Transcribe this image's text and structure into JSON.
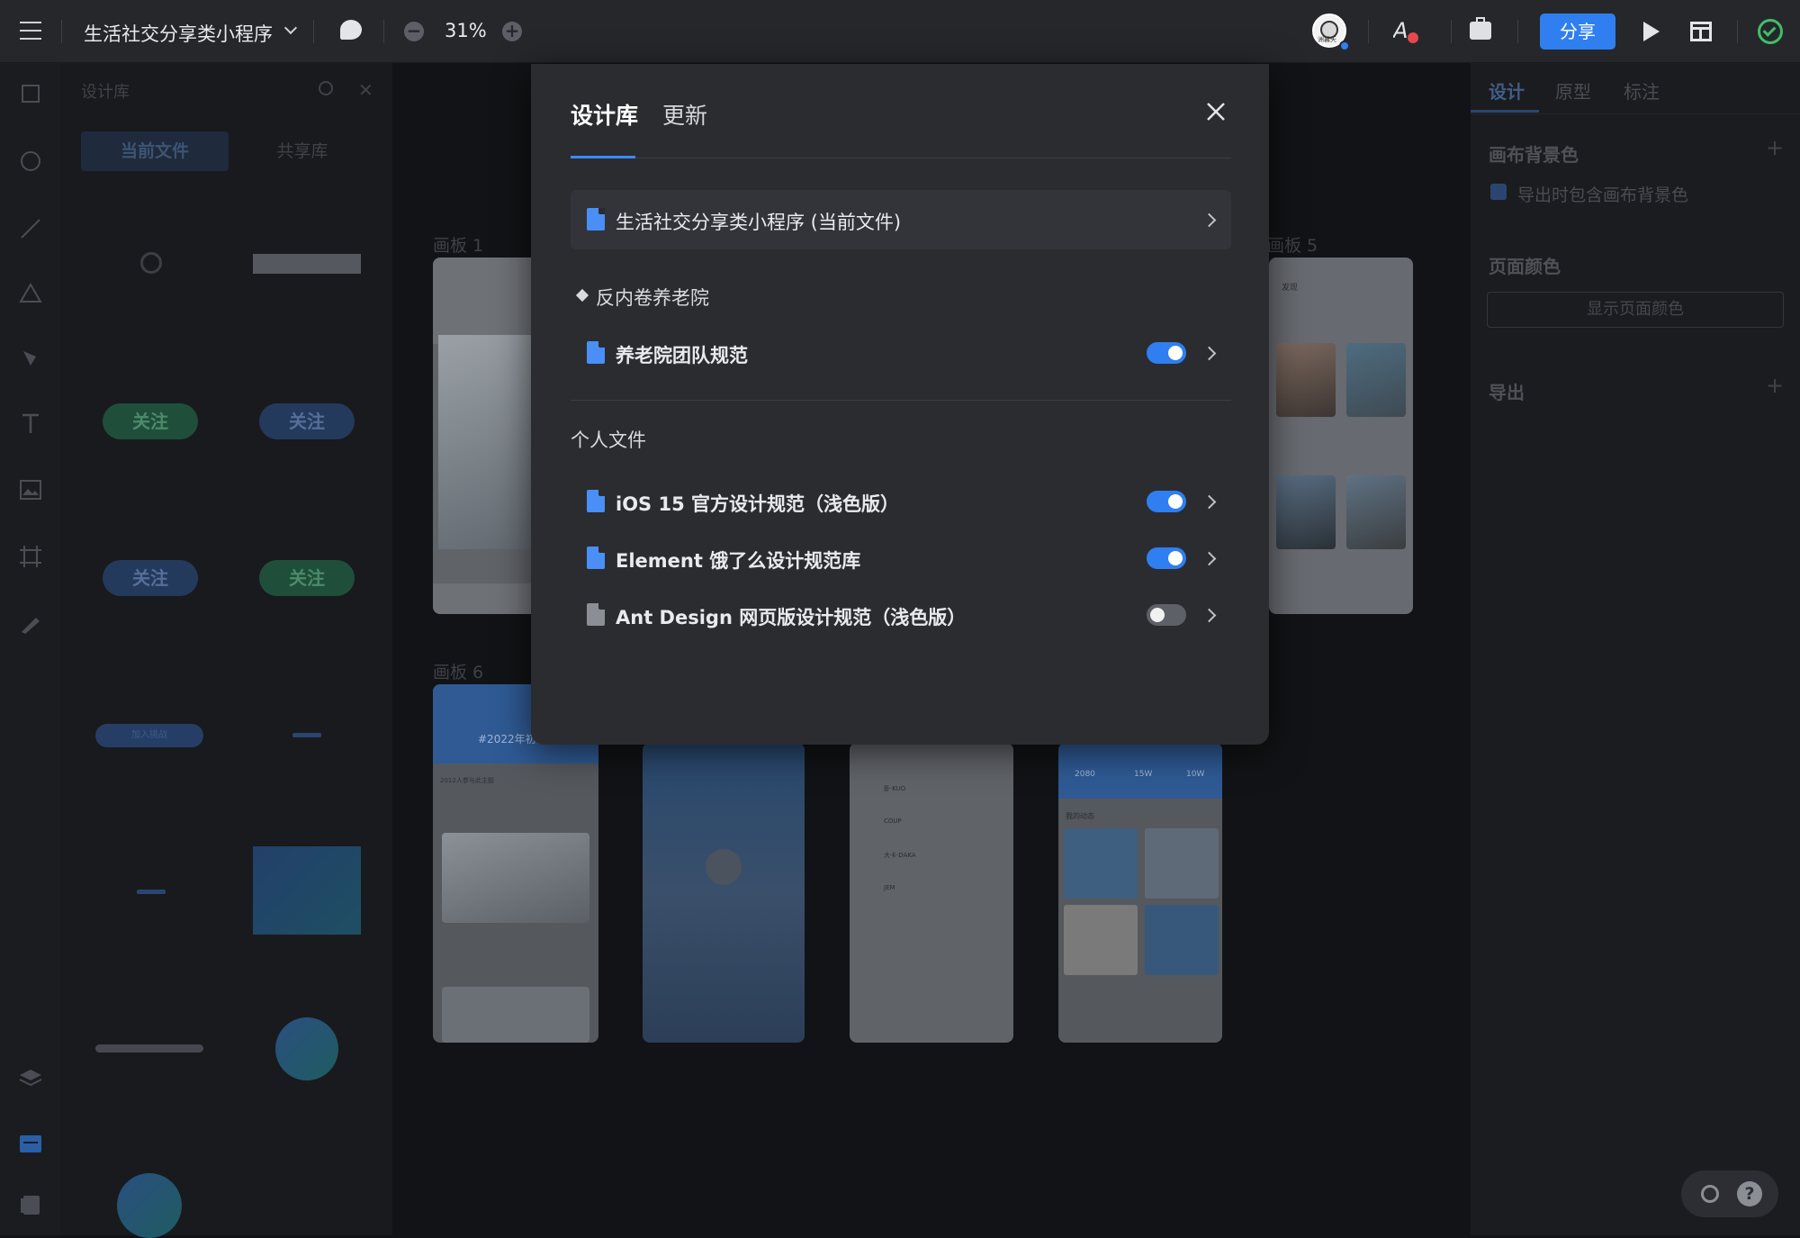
{
  "header": {
    "file_title": "生活社交分享类小程序",
    "zoom": "31%",
    "share_label": "分享",
    "avatar_text": "洲暮天"
  },
  "left_panel": {
    "title": "设计库",
    "tabs": [
      "当前文件",
      "共享库"
    ],
    "components": [
      "关注",
      "关注",
      "关注",
      "关注",
      "加入挑战"
    ]
  },
  "canvas": {
    "board_labels": [
      "画板 1",
      "画板 5",
      "画板 6"
    ],
    "board6_text": [
      "#2022年初雪",
      "2012人参与此主题"
    ],
    "chat_names": [
      "卧·KUO",
      "COUP",
      "大卡·DAKA",
      "JEM"
    ],
    "profile_stats": [
      "2080",
      "15W",
      "10W"
    ],
    "profile_section": "我的动态",
    "board5_title": "发现"
  },
  "right_panel": {
    "tabs": [
      "设计",
      "原型",
      "标注"
    ],
    "canvas_bg_title": "画布背景色",
    "export_bg_label": "导出时包含画布背景色",
    "page_color_title": "页面颜色",
    "show_page_color_label": "显示页面颜色",
    "export_title": "导出"
  },
  "modal": {
    "tabs": [
      "设计库",
      "更新"
    ],
    "current_file": "生活社交分享类小程序 (当前文件)",
    "team_name": "反内卷养老院",
    "team_libraries": [
      {
        "name": "养老院团队规范",
        "enabled": true
      }
    ],
    "personal_title": "个人文件",
    "personal_libraries": [
      {
        "name": "iOS 15 官方设计规范（浅色版）",
        "enabled": true
      },
      {
        "name": "Element 饿了么设计规范库",
        "enabled": true
      },
      {
        "name": "Ant Design 网页版设计规范（浅色版）",
        "enabled": false
      }
    ]
  }
}
